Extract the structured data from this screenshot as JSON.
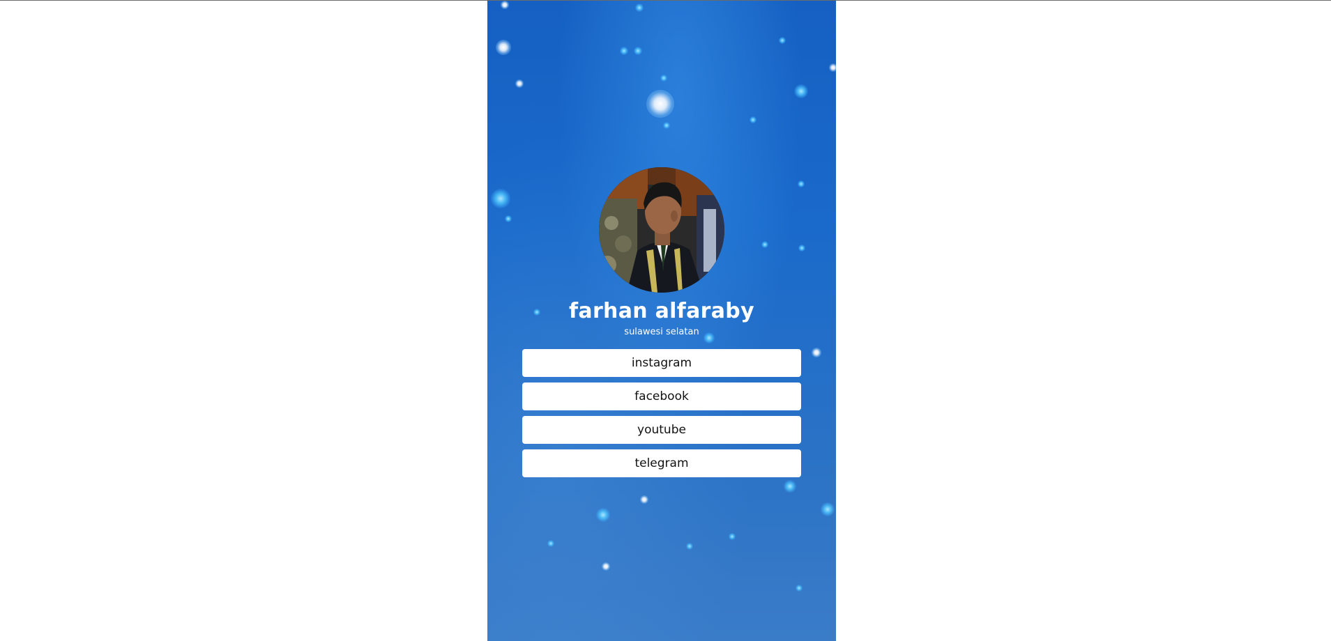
{
  "profile": {
    "name": "farhan alfaraby",
    "location": "sulawesi selatan"
  },
  "links": [
    {
      "label": "instagram"
    },
    {
      "label": "facebook"
    },
    {
      "label": "youtube"
    },
    {
      "label": "telegram"
    }
  ],
  "colors": {
    "background_blue": "#1a6acb",
    "button_bg": "#ffffff",
    "button_text": "#111111",
    "name_text": "#ffffff"
  }
}
